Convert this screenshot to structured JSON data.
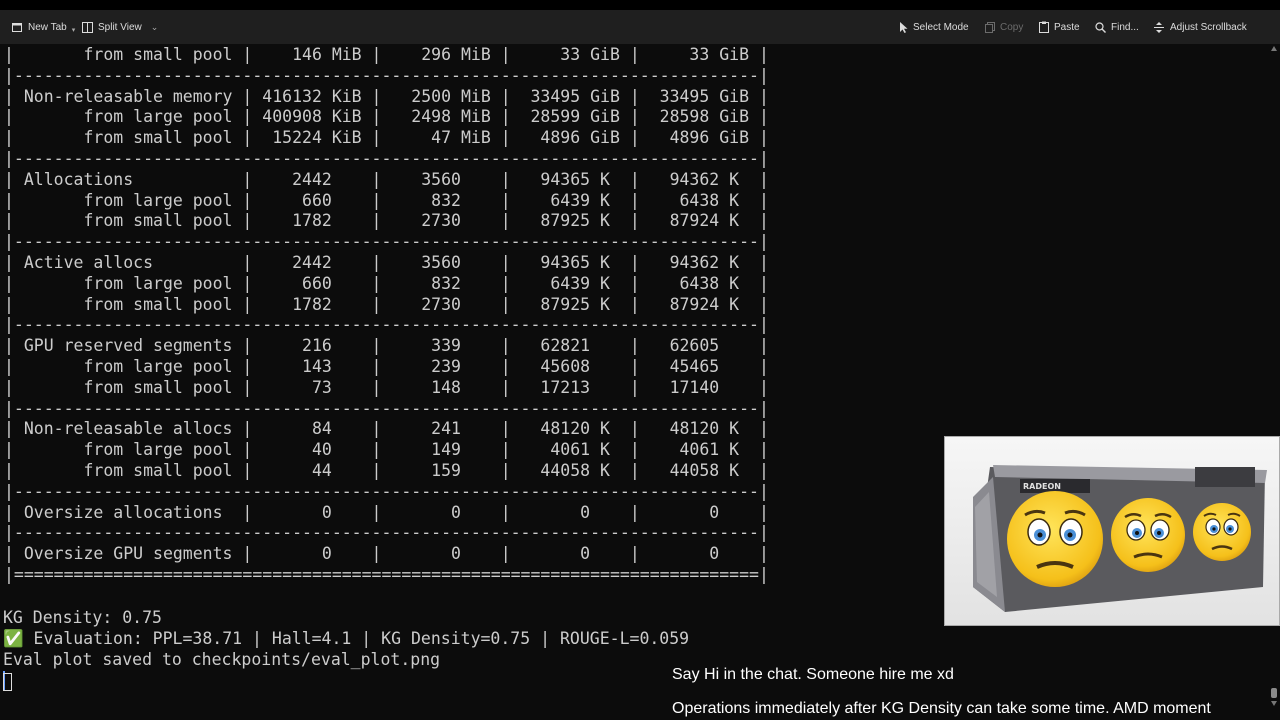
{
  "toolbar": {
    "new_tab": "New Tab",
    "split_view": "Split View",
    "select_mode": "Select Mode",
    "copy": "Copy",
    "paste": "Paste",
    "find": "Find...",
    "adjust_scrollback": "Adjust Scrollback"
  },
  "terminal": {
    "lines": [
      "|       from small pool |    146 MiB |    296 MiB |     33 GiB |     33 GiB |",
      "|---------------------------------------------------------------------------|",
      "| Non-releasable memory | 416132 KiB |   2500 MiB |  33495 GiB |  33495 GiB |",
      "|       from large pool | 400908 KiB |   2498 MiB |  28599 GiB |  28598 GiB |",
      "|       from small pool |  15224 KiB |     47 MiB |   4896 GiB |   4896 GiB |",
      "|---------------------------------------------------------------------------|",
      "| Allocations           |    2442    |    3560    |   94365 K  |   94362 K  |",
      "|       from large pool |     660    |     832    |    6439 K  |    6438 K  |",
      "|       from small pool |    1782    |    2730    |   87925 K  |   87924 K  |",
      "|---------------------------------------------------------------------------|",
      "| Active allocs         |    2442    |    3560    |   94365 K  |   94362 K  |",
      "|       from large pool |     660    |     832    |    6439 K  |    6438 K  |",
      "|       from small pool |    1782    |    2730    |   87925 K  |   87924 K  |",
      "|---------------------------------------------------------------------------|",
      "| GPU reserved segments |     216    |     339    |   62821    |   62605    |",
      "|       from large pool |     143    |     239    |   45608    |   45465    |",
      "|       from small pool |      73    |     148    |   17213    |   17140    |",
      "|---------------------------------------------------------------------------|",
      "| Non-releasable allocs |      84    |     241    |   48120 K  |   48120 K  |",
      "|       from large pool |      40    |     149    |    4061 K  |    4061 K  |",
      "|       from small pool |      44    |     159    |   44058 K  |   44058 K  |",
      "|---------------------------------------------------------------------------|",
      "| Oversize allocations  |       0    |       0    |       0    |       0    |",
      "|---------------------------------------------------------------------------|",
      "| Oversize GPU segments |       0    |       0    |       0    |       0    |",
      "|===========================================================================|",
      "",
      "KG Density: 0.75",
      "✅ Evaluation: PPL=38.71 | Hall=4.1 | KG Density=0.75 | ROUGE-L=0.059",
      "Eval plot saved to checkpoints/eval_plot.png"
    ]
  },
  "webcam": {
    "gpu_brand_text": "RADEON"
  },
  "overlay": {
    "chat_message": "Say Hi in the chat. Someone hire me xd",
    "ticker_message": "Operations immediately after KG Density can take some time. AMD moment"
  },
  "colors": {
    "terminal_bg": "#0c0c0c",
    "terminal_fg": "#cccccc",
    "toolbar_bg": "#1f1f1f",
    "emoji_face": "#f5c01a"
  }
}
